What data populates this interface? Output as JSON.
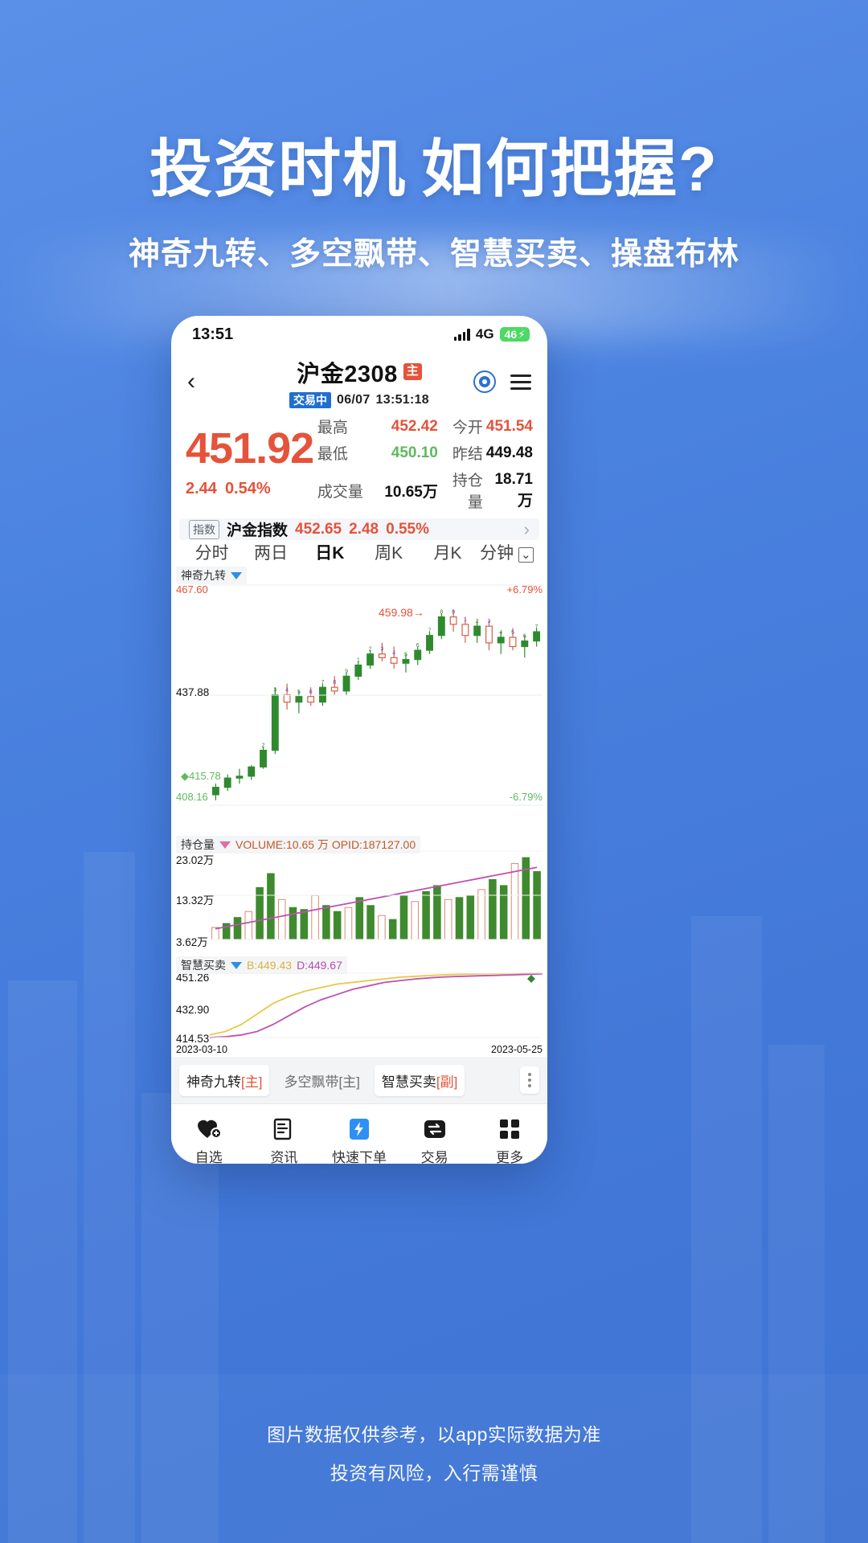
{
  "poster": {
    "headline_left": "投资时机",
    "headline_right": "如何把握?",
    "subline": "神奇九转、多空飘带、智慧买卖、操盘布林",
    "footer_line1": "图片数据仅供参考，以app实际数据为准",
    "footer_line2": "投资有风险，入行需谨慎",
    "bg_color": "#4a82e0"
  },
  "statusbar": {
    "time": "13:51",
    "network": "4G",
    "battery": "46",
    "signal_icon": "signal-bars-icon",
    "battery_color": "#4cd964"
  },
  "header": {
    "back_icon": "chevron-left-icon",
    "symbol": "沪金2308",
    "main_badge": "主",
    "status_badge": "交易中",
    "date": "06/07",
    "time": "13:51:18",
    "target_icon": "crosshair-icon",
    "menu_icon": "hamburger-menu-icon"
  },
  "quote": {
    "last_price": "451.92",
    "change": "2.44",
    "change_pct": "0.54%",
    "up_color": "#e4533a",
    "down_color": "#5eb95e",
    "rows": [
      {
        "l1": "最高",
        "v1": "452.42",
        "c1": "up",
        "l2": "今开",
        "v2": "451.54",
        "c2": "up"
      },
      {
        "l1": "最低",
        "v1": "450.10",
        "c1": "down",
        "l2": "昨结",
        "v2": "449.48",
        "c2": "flat"
      },
      {
        "l1": "成交量",
        "v1": "10.65万",
        "c1": "flat",
        "l2": "持仓量",
        "v2": "18.71万",
        "c2": "flat"
      }
    ]
  },
  "index_bar": {
    "tag": "指数",
    "name": "沪金指数",
    "value": "452.65",
    "change": "2.48",
    "change_pct": "0.55%",
    "arrow_icon": "chevron-right-icon"
  },
  "period_tabs": [
    {
      "label": "分时",
      "active": false
    },
    {
      "label": "两日",
      "active": false
    },
    {
      "label": "日K",
      "active": true
    },
    {
      "label": "周K",
      "active": false
    },
    {
      "label": "月K",
      "active": false
    },
    {
      "label": "分钟",
      "active": false,
      "suffix_icon": "dropdown-box-icon"
    }
  ],
  "chart_data": {
    "type": "line",
    "title": "沪金2308 日K",
    "main_panel": {
      "indicator": "神奇九转",
      "dropdown_icon": "triangle-down-icon",
      "y_top": "467.60",
      "y_mid": "437.88",
      "y_bottom": "408.16",
      "pct_top": "+6.79%",
      "pct_bottom": "-6.79%",
      "annotation_price": "459.98",
      "annotation_arrow": "→",
      "marker_price": "415.78",
      "ylim": [
        408.16,
        467.6
      ],
      "candles": [
        {
          "o": 411.0,
          "h": 414.0,
          "l": 409.5,
          "c": 413.0,
          "d": "up"
        },
        {
          "o": 413.0,
          "h": 416.5,
          "l": 412.0,
          "c": 415.5,
          "d": "up"
        },
        {
          "o": 415.5,
          "h": 418.0,
          "l": 414.0,
          "c": 416.0,
          "d": "up"
        },
        {
          "o": 416.0,
          "h": 419.0,
          "l": 415.0,
          "c": 418.5,
          "d": "up"
        },
        {
          "o": 418.5,
          "h": 424.0,
          "l": 418.0,
          "c": 423.0,
          "d": "up"
        },
        {
          "o": 423.0,
          "h": 440.0,
          "l": 422.0,
          "c": 438.0,
          "d": "up"
        },
        {
          "o": 438.0,
          "h": 441.0,
          "l": 434.0,
          "c": 436.0,
          "d": "down"
        },
        {
          "o": 436.0,
          "h": 439.0,
          "l": 433.0,
          "c": 437.5,
          "d": "up"
        },
        {
          "o": 437.5,
          "h": 440.0,
          "l": 435.0,
          "c": 436.0,
          "d": "down"
        },
        {
          "o": 436.0,
          "h": 441.0,
          "l": 435.0,
          "c": 440.0,
          "d": "up"
        },
        {
          "o": 440.0,
          "h": 443.0,
          "l": 438.0,
          "c": 439.0,
          "d": "down"
        },
        {
          "o": 439.0,
          "h": 444.0,
          "l": 438.0,
          "c": 443.0,
          "d": "up"
        },
        {
          "o": 443.0,
          "h": 447.0,
          "l": 442.0,
          "c": 446.0,
          "d": "up"
        },
        {
          "o": 446.0,
          "h": 450.0,
          "l": 445.0,
          "c": 449.0,
          "d": "up"
        },
        {
          "o": 449.0,
          "h": 452.0,
          "l": 447.0,
          "c": 448.0,
          "d": "down"
        },
        {
          "o": 448.0,
          "h": 451.0,
          "l": 445.0,
          "c": 446.5,
          "d": "down"
        },
        {
          "o": 446.5,
          "h": 449.0,
          "l": 444.0,
          "c": 447.5,
          "d": "up"
        },
        {
          "o": 447.5,
          "h": 451.0,
          "l": 446.0,
          "c": 450.0,
          "d": "up"
        },
        {
          "o": 450.0,
          "h": 455.0,
          "l": 449.0,
          "c": 454.0,
          "d": "up"
        },
        {
          "o": 454.0,
          "h": 460.0,
          "l": 453.0,
          "c": 459.0,
          "d": "up"
        },
        {
          "o": 459.0,
          "h": 461.0,
          "l": 455.0,
          "c": 457.0,
          "d": "down"
        },
        {
          "o": 457.0,
          "h": 459.0,
          "l": 452.0,
          "c": 454.0,
          "d": "down"
        },
        {
          "o": 454.0,
          "h": 458.0,
          "l": 452.0,
          "c": 456.5,
          "d": "up"
        },
        {
          "o": 456.5,
          "h": 458.0,
          "l": 450.0,
          "c": 452.0,
          "d": "down"
        },
        {
          "o": 452.0,
          "h": 455.0,
          "l": 449.0,
          "c": 453.5,
          "d": "up"
        },
        {
          "o": 453.5,
          "h": 456.0,
          "l": 450.0,
          "c": 451.0,
          "d": "down"
        },
        {
          "o": 451.0,
          "h": 454.0,
          "l": 448.0,
          "c": 452.5,
          "d": "up"
        },
        {
          "o": 452.5,
          "h": 456.0,
          "l": 451.0,
          "c": 455.0,
          "d": "up"
        }
      ]
    },
    "volume_panel": {
      "indicator": "持仓量",
      "dropdown_icon": "triangle-down-icon",
      "legend": "VOLUME:10.65 万 OPID:187127.00",
      "y_top": "23.02万",
      "y_mid": "13.32万",
      "y_bottom": "3.62万",
      "ylim": [
        3.62,
        23.02
      ],
      "bars": [
        6,
        8,
        11,
        14,
        26,
        33,
        20,
        16,
        15,
        22,
        17,
        14,
        16,
        21,
        17,
        12,
        10,
        22,
        19,
        24,
        27,
        20,
        21,
        22,
        25,
        30,
        27,
        38,
        41,
        34
      ]
    },
    "sub_panel": {
      "indicator": "智慧买卖",
      "dropdown_icon": "triangle-down-icon",
      "legend_b": "B:449.43",
      "legend_d": "D:449.67",
      "y_top": "451.26",
      "y_mid": "432.90",
      "y_bottom": "414.53",
      "ylim": [
        414.53,
        451.26
      ],
      "x_start": "2023-03-10",
      "x_end": "2023-05-25",
      "series": [
        {
          "name": "B",
          "color": "#e8c84a",
          "values": [
            416,
            418,
            422,
            428,
            434,
            438,
            441,
            443,
            445,
            446,
            447,
            448,
            449,
            449.5,
            450,
            450.4,
            450.7,
            450.9,
            451,
            451.1,
            451.2,
            451.26
          ]
        },
        {
          "name": "D",
          "color": "#c050b0",
          "values": [
            414.5,
            415,
            416,
            418,
            422,
            427,
            432,
            436,
            439,
            442,
            444,
            446,
            447,
            448,
            448.7,
            449.2,
            449.5,
            449.8,
            450,
            450.3,
            450.6,
            450.9
          ]
        }
      ]
    }
  },
  "indicator_chips": [
    {
      "name": "神奇九转",
      "suffix": "[主]",
      "active": true
    },
    {
      "name": "多空飘带",
      "suffix": "[主]",
      "active": false
    },
    {
      "name": "智慧买卖",
      "suffix": "[副]",
      "active": true
    }
  ],
  "chips_more_icon": "more-vertical-icon",
  "bottom_nav": [
    {
      "label": "自选",
      "icon": "heart-plus-icon"
    },
    {
      "label": "资讯",
      "icon": "news-icon"
    },
    {
      "label": "快速下单",
      "icon": "lightning-order-icon"
    },
    {
      "label": "交易",
      "icon": "exchange-icon"
    },
    {
      "label": "更多",
      "icon": "grid-more-icon"
    }
  ]
}
